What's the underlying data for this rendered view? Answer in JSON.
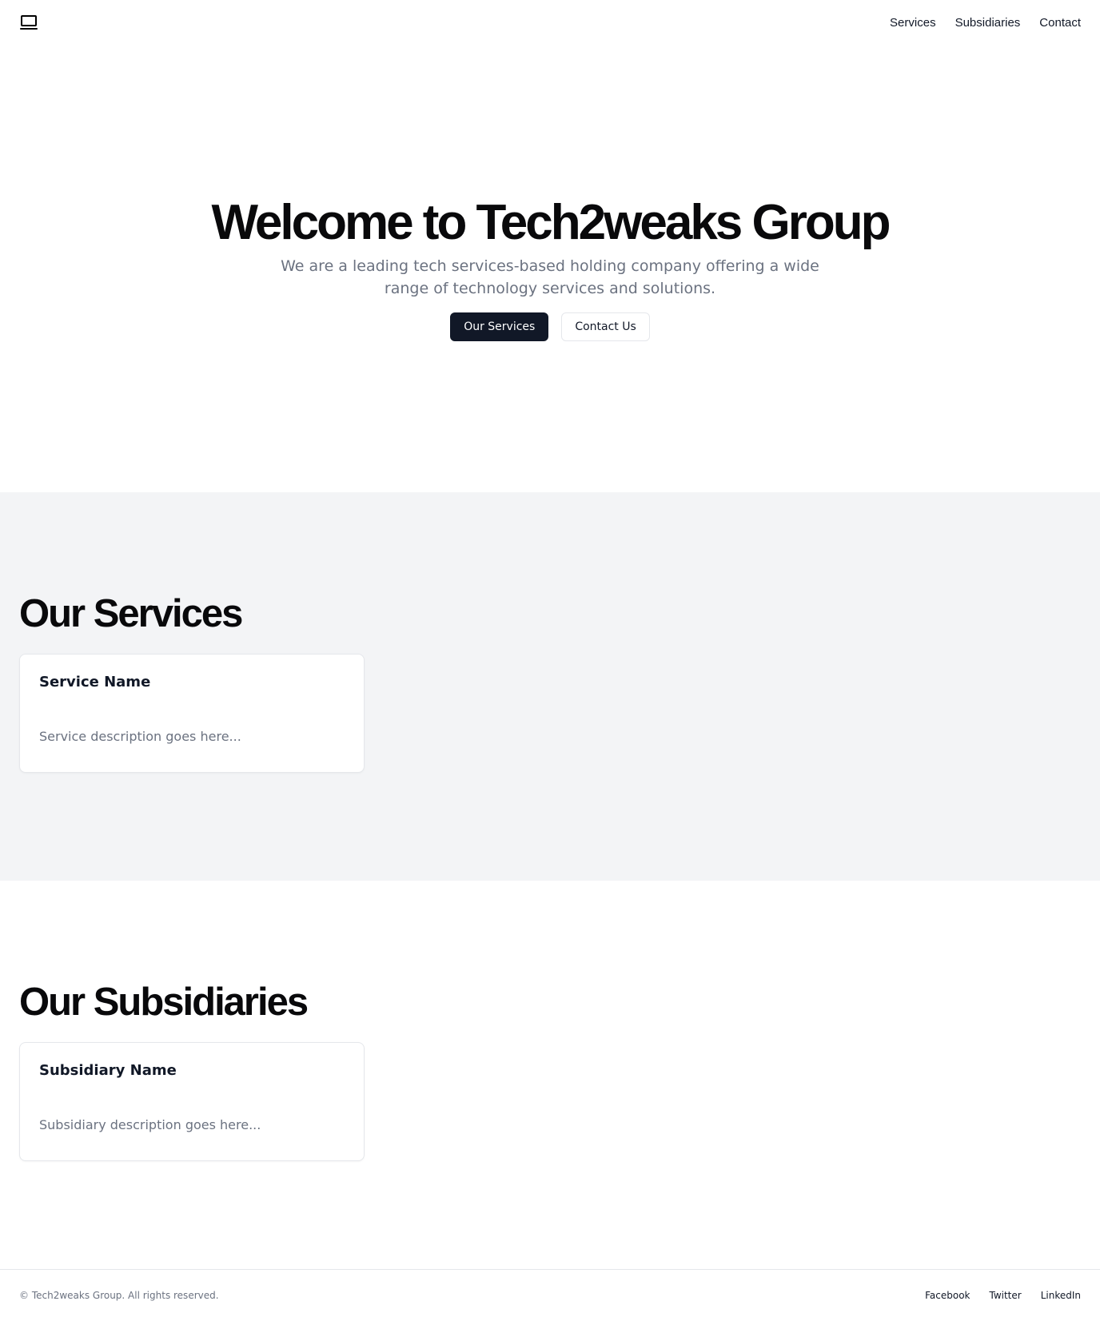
{
  "header": {
    "logo_icon": "laptop-icon",
    "nav": [
      "Services",
      "Subsidiaries",
      "Contact"
    ]
  },
  "hero": {
    "title": "Welcome to Tech2weaks Group",
    "subtitle": "We are a leading tech services-based holding company offering a wide range of technology services and solutions.",
    "primary_button": "Our Services",
    "secondary_button": "Contact Us"
  },
  "services": {
    "heading": "Our Services",
    "card": {
      "title": "Service Name",
      "description": "Service description goes here..."
    }
  },
  "subsidiaries": {
    "heading": "Our Subsidiaries",
    "card": {
      "title": "Subsidiary Name",
      "description": "Subsidiary description goes here..."
    }
  },
  "footer": {
    "copyright": "© Tech2weaks Group. All rights reserved.",
    "links": [
      "Facebook",
      "Twitter",
      "LinkedIn"
    ]
  },
  "colors": {
    "primary": "#111827",
    "muted_text": "#6b7280",
    "section_bg": "#f3f4f6",
    "border": "#e5e7eb"
  }
}
